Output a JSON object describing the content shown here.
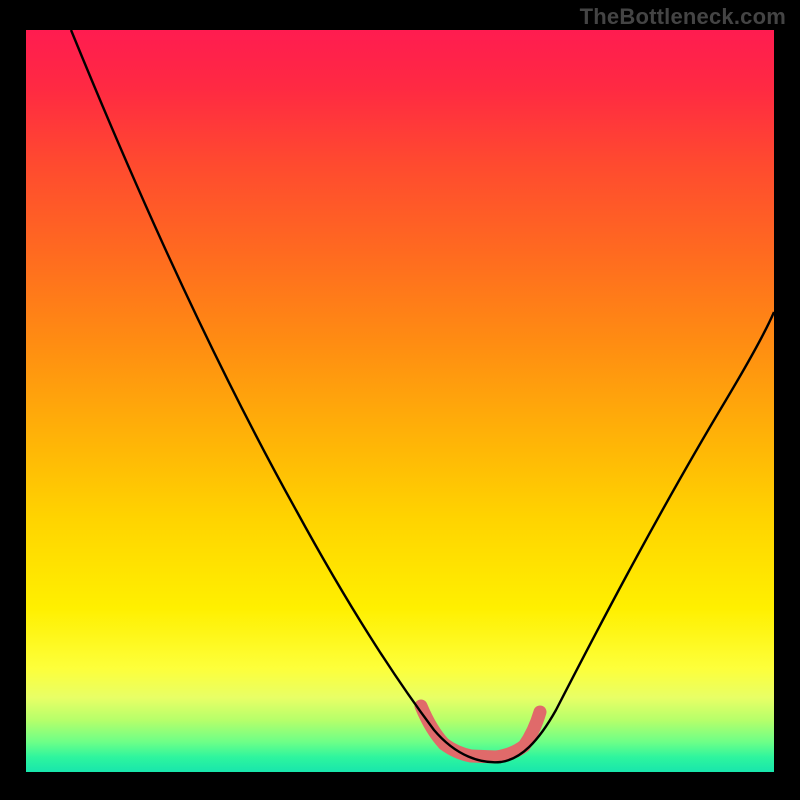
{
  "watermark": "TheBottleneck.com",
  "chart_data": {
    "type": "line",
    "title": "",
    "xlabel": "",
    "ylabel": "",
    "xlim": [
      0,
      100
    ],
    "ylim": [
      0,
      100
    ],
    "grid": false,
    "series": [
      {
        "name": "curve",
        "x": [
          6,
          10,
          15,
          20,
          25,
          30,
          35,
          40,
          45,
          50,
          53,
          56,
          59,
          62,
          65,
          67,
          70,
          75,
          80,
          85,
          90,
          95,
          100
        ],
        "y": [
          100,
          93,
          85,
          77,
          69,
          61,
          52,
          43,
          34,
          23,
          14,
          8,
          4,
          2,
          2,
          3,
          7,
          17,
          29,
          40,
          51,
          60,
          68
        ]
      }
    ],
    "highlight": {
      "name": "bottom-band",
      "region_x": [
        53,
        67
      ],
      "region_y": [
        2,
        8
      ],
      "color": "#e06a6a"
    },
    "background_gradient": {
      "stops": [
        {
          "pos": 0.0,
          "color": "#ff1c50"
        },
        {
          "pos": 0.3,
          "color": "#ff6a20"
        },
        {
          "pos": 0.66,
          "color": "#ffd400"
        },
        {
          "pos": 0.9,
          "color": "#e8ff66"
        },
        {
          "pos": 1.0,
          "color": "#18e6ac"
        }
      ]
    }
  }
}
